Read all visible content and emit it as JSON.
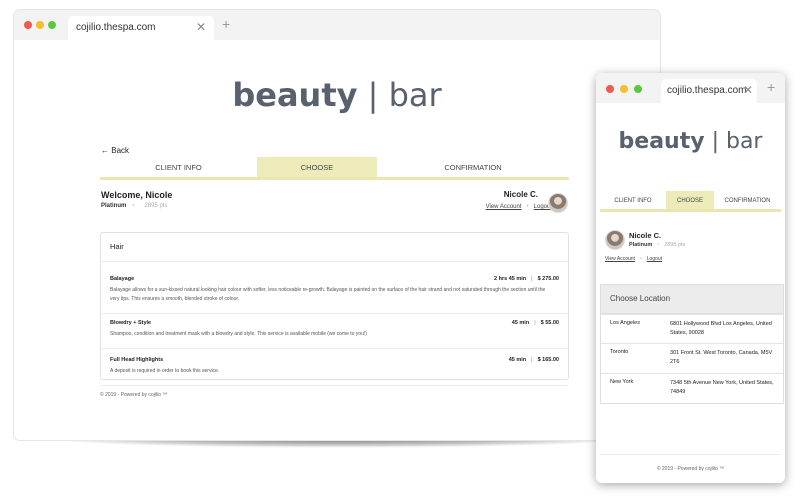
{
  "desktop": {
    "tab_title": "cojilio.thespa.com",
    "tab_close": "✕",
    "new_tab": "+",
    "logo_bold": "beauty",
    "logo_rest": " | bar",
    "back_label": "Back",
    "steps": [
      "CLIENT INFO",
      "CHOOSE",
      "CONFIRMATION"
    ],
    "active_step": "CHOOSE",
    "welcome": "Welcome, Nicole",
    "tier": "Platinum",
    "points": "2895 pts",
    "user_name": "Nicole C.",
    "view_account": "View Account",
    "logout": "Logout",
    "category": "Hair",
    "services": [
      {
        "name": "Balayage",
        "duration": "2 hrs 45 min",
        "price": "$ 275.00",
        "description": "Balayage allows for a sun-kissed natural looking hair colour with softer, less noticeable re-growth. Balayage is painted on the surface of the hair strand and not saturated through the section until the very tips. This ensures a smooth, blended stroke of colour."
      },
      {
        "name": "Blowdry + Style",
        "duration": "45 min",
        "price": "$ 55.00",
        "description": "Shampoo, condition and treatment mask with a blowdry and style. This service is available mobile (we come to you!)"
      },
      {
        "name": "Full Head Highlights",
        "duration": "45 min",
        "price": "$ 165.00",
        "description": "A deposit is required in order to book this service."
      }
    ],
    "footer": "© 2019 - Powered by cojilio ™"
  },
  "mobile": {
    "tab_title": "cojilio.thespa.com",
    "tab_close": "✕",
    "new_tab": "+",
    "logo_bold": "beauty",
    "logo_rest": " | bar",
    "steps": [
      "CLIENT INFO",
      "CHOOSE",
      "CONFIRMATION"
    ],
    "user_name": "Nicole C.",
    "tier": "Platinum",
    "points": "2895 pts",
    "view_account": "View Account",
    "logout": "Logout",
    "location_header": "Choose Location",
    "locations": [
      {
        "city": "Los Angeles",
        "address": "6801 Hollywood Blvd Los Angeles, United States, 90028"
      },
      {
        "city": "Toronto",
        "address": "301 Front St. West Toronto, Canada, M5V 2T6"
      },
      {
        "city": "New York",
        "address": "7348 5th Avenue New York, United States, 74849"
      }
    ],
    "footer": "© 2019 - Powered by cojilio ™"
  },
  "colors": {
    "accent": "#ecebb9",
    "logo": "#59606e",
    "dot_red": "#ee5a52",
    "dot_yellow": "#f6bd2e",
    "dot_green": "#5bc940"
  },
  "icons": {
    "back": "arrow-left-icon",
    "close_tab": "close-icon",
    "new_tab": "plus-icon"
  }
}
